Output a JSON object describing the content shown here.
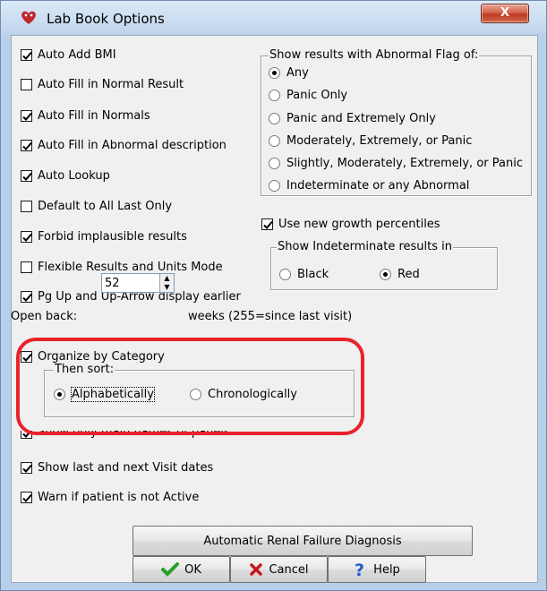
{
  "window": {
    "title": "Lab Book Options",
    "close_label": "X",
    "app_icon": "lab-book-icon"
  },
  "left_options": [
    {
      "label": "Auto Add BMI",
      "checked": true
    },
    {
      "label": "Auto Fill in Normal Result",
      "checked": false
    },
    {
      "label": "Auto Fill in Normals",
      "checked": true
    },
    {
      "label": "Auto Fill in Abnormal description",
      "checked": true
    },
    {
      "label": "Auto Lookup",
      "checked": true
    },
    {
      "label": "Default to All Last Only",
      "checked": false
    },
    {
      "label": "Forbid implausible results",
      "checked": true
    },
    {
      "label": "Flexible Results and Units Mode",
      "checked": false
    },
    {
      "label": "Pg Up and Up-Arrow display earlier",
      "checked": true
    }
  ],
  "open_back": {
    "label": "Open back:",
    "value": "52",
    "suffix": "weeks (255=since last visit)"
  },
  "organize": {
    "label": "Organize by Category",
    "checked": true,
    "then_sort_label": "Then sort:",
    "options": [
      "Alphabetically",
      "Chronologically"
    ],
    "selected": "Alphabetically"
  },
  "lower_options": [
    {
      "label": "Show only main names of panels",
      "checked": true
    },
    {
      "label": "Show last and next Visit dates",
      "checked": true
    },
    {
      "label": "Warn if patient is not Active",
      "checked": true
    }
  ],
  "abnormal_flag": {
    "label": "Show results with Abnormal Flag of:",
    "options": [
      "Any",
      "Panic Only",
      "Panic and Extremely Only",
      "Moderately, Extremely, or Panic",
      "Slightly, Moderately, Extremely, or Panic",
      "Indeterminate or any Abnormal"
    ],
    "selected": "Any"
  },
  "growth": {
    "label": "Use new growth percentiles",
    "checked": true
  },
  "indeterminate": {
    "label": "Show Indeterminate results in",
    "options": [
      "Black",
      "Red"
    ],
    "selected": "Red"
  },
  "buttons": {
    "renal": "Automatic Renal Failure Diagnosis",
    "ok": "OK",
    "cancel": "Cancel",
    "help": "Help"
  },
  "colors": {
    "highlight": "#e8232b",
    "ok_icon": "#2a9d2a",
    "cancel_icon": "#c8161d",
    "help_icon": "#1f5fc8"
  }
}
